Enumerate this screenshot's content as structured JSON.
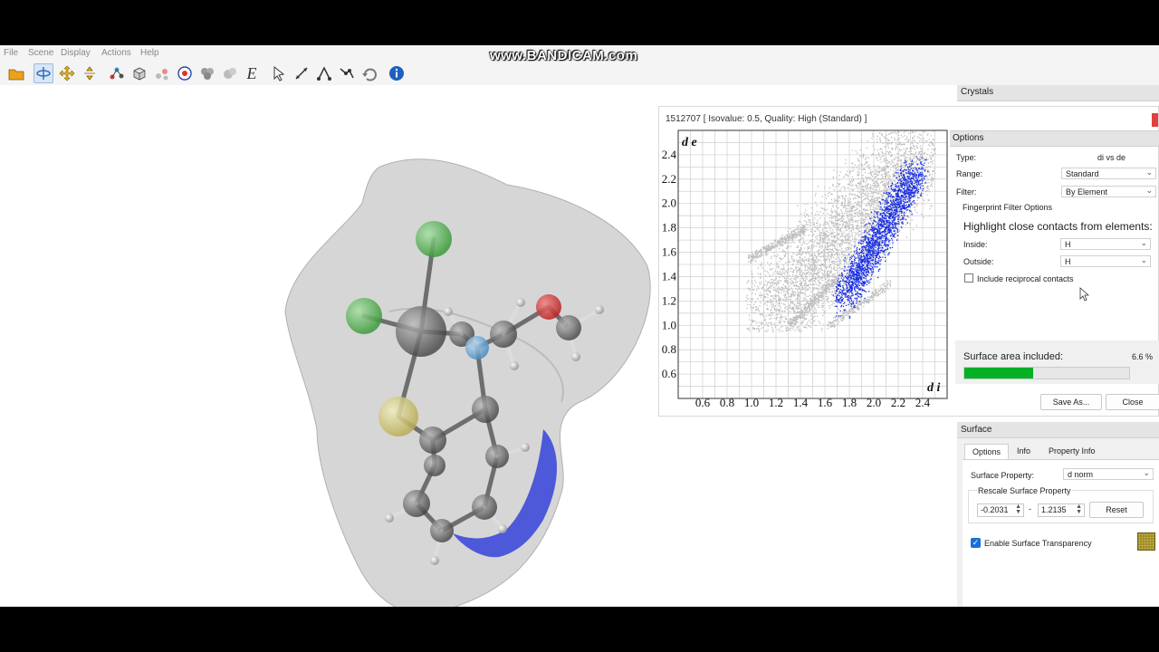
{
  "watermark": "www.BANDICAM.com",
  "menu": [
    "File",
    "Scene",
    "Display",
    "Actions",
    "Help"
  ],
  "toolbar_icons": [
    "open-folder-icon",
    "rotate-icon",
    "translate-icon",
    "scale-icon",
    "molecule-fragment-icon",
    "unit-cell-icon",
    "atoms-icon",
    "center-icon",
    "cluster-icon",
    "cluster-gray-icon",
    "energy-e-icon",
    "select-arrow-icon",
    "measure-distance-icon",
    "measure-angle-icon",
    "measure-torsion-icon",
    "undo-icon",
    "info-icon"
  ],
  "fingerprint": {
    "title": "1512707 [ Isovalue: 0.5, Quality: High (Standard) ]",
    "axis_y_label": "d e",
    "axis_x_label": "d i",
    "options_header": "Options",
    "type_label": "Type:",
    "type_value": "di vs de",
    "range_label": "Range:",
    "range_value": "Standard",
    "filter_label": "Filter:",
    "filter_value": "By Element",
    "filter_options_title": "Fingerprint Filter Options",
    "highlight_title": "Highlight close contacts from elements:",
    "inside_label": "Inside:",
    "inside_value": "H",
    "outside_label": "Outside:",
    "outside_value": "H",
    "reciprocal_label": "Include reciprocal contacts",
    "reciprocal_checked": false,
    "surface_area_label": "Surface area included:",
    "surface_area_value": "6.6 %",
    "surface_area_fraction": 0.066,
    "save_as": "Save As...",
    "close": "Close"
  },
  "chart_data": {
    "type": "scatter",
    "xlabel": "d i",
    "ylabel": "d e",
    "x_ticks": [
      "0.6",
      "0.8",
      "1.0",
      "1.2",
      "1.4",
      "1.6",
      "1.8",
      "2.0",
      "2.2",
      "2.4"
    ],
    "y_ticks": [
      "2.4",
      "2.2",
      "2.0",
      "1.8",
      "1.6",
      "1.4",
      "1.2",
      "1.0",
      "0.8",
      "0.6"
    ],
    "xlim": [
      0.4,
      2.6
    ],
    "ylim": [
      0.4,
      2.6
    ],
    "grid": true,
    "series": [
      {
        "color": "#bdbdbd",
        "shape": "full fingerprint"
      },
      {
        "color": "#1a2fe0",
        "shape": "H...H highlighted contacts"
      }
    ]
  },
  "dock": {
    "crystals_header": "Crystals",
    "surface_header": "Surface",
    "tabs": [
      "Options",
      "Info",
      "Property Info"
    ],
    "surface_property_label": "Surface Property:",
    "surface_property_value": "d norm",
    "rescale_title": "Rescale Surface Property",
    "min_value": "-0.2031",
    "max_value": "1.2135",
    "dash": "-",
    "reset": "Reset",
    "transparency_label": "Enable Surface Transparency",
    "transparency_checked": true
  }
}
